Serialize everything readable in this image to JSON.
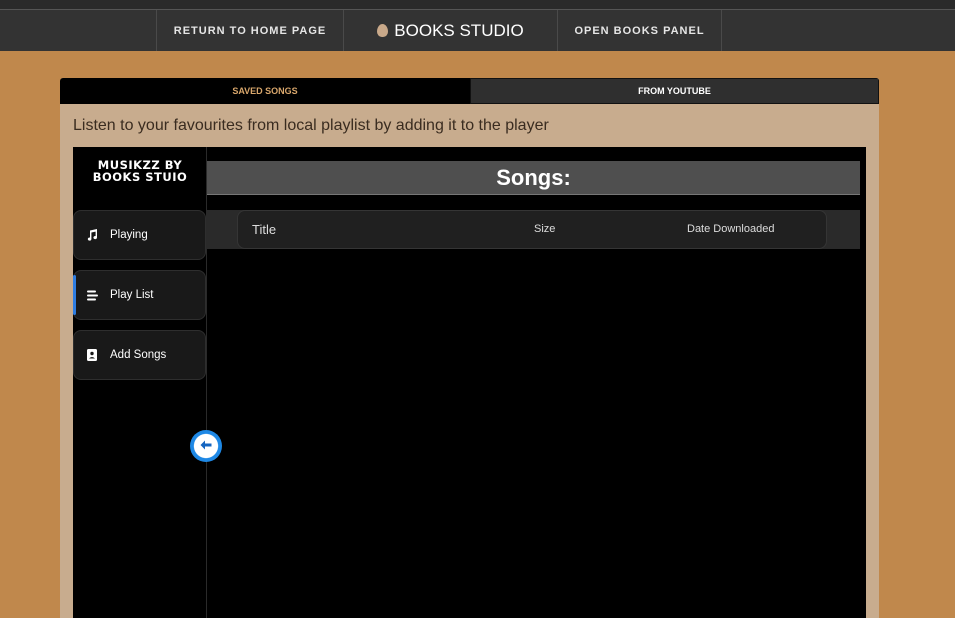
{
  "topnav": {
    "home": "RETURN TO HOME PAGE",
    "brand": "BOOKS STUDIO",
    "panel": "OPEN BOOKS PANEL"
  },
  "tabs": [
    {
      "label": "SAVED SONGS",
      "active": true
    },
    {
      "label": "FROM YOUTUBE",
      "active": false
    }
  ],
  "intro": "Listen to your favourites from local playlist by adding it to the player",
  "player": {
    "logo_line1": "MUSIKZZ BY",
    "logo_line2": "BOOKS STUIO",
    "sidebar": [
      {
        "label": "Playing",
        "icon": "music-note-icon"
      },
      {
        "label": "Play List",
        "icon": "list-icon",
        "active": true
      },
      {
        "label": "Add Songs",
        "icon": "contact-book-icon"
      }
    ],
    "songs_title": "Songs:",
    "columns": {
      "title": "Title",
      "size": "Size",
      "date": "Date Downloaded"
    }
  },
  "colors": {
    "background": "#c0884c",
    "topbar": "#333333",
    "panel": "#c8ac8e",
    "active_tab_text": "#d9a76c",
    "active_indicator": "#2f7de1"
  }
}
